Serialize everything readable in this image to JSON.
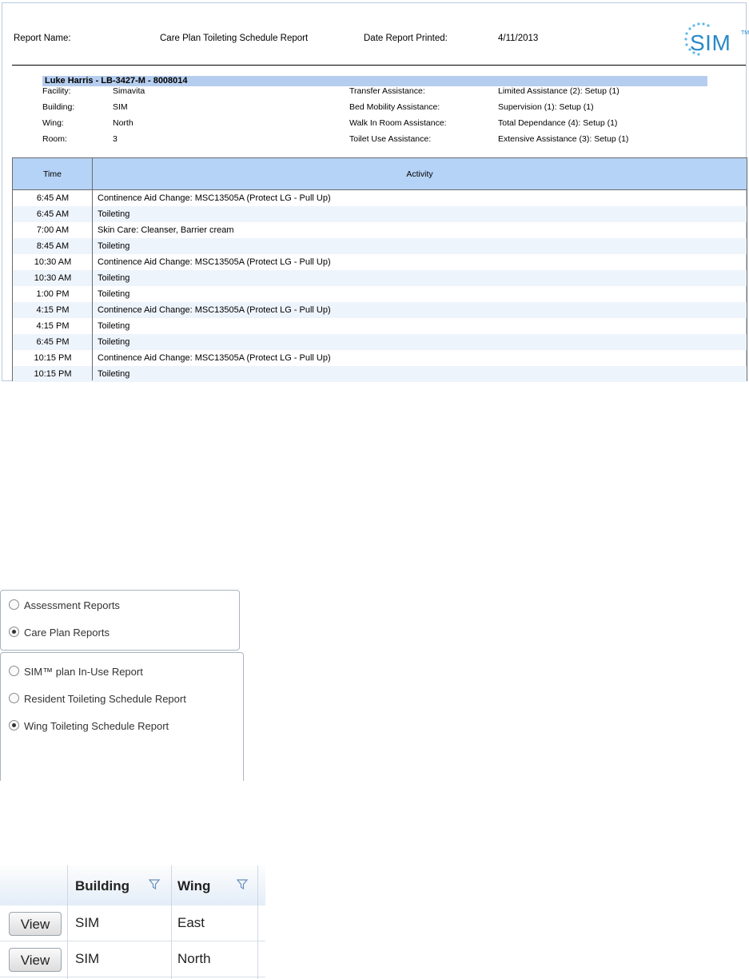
{
  "report": {
    "report_name_label": "Report Name:",
    "report_name": "Care Plan Toileting Schedule Report",
    "date_label": "Date Report Printed:",
    "date": "4/11/2013",
    "logo_text": "SIM",
    "logo_tm": "TM",
    "resident": "Luke Harris - LB-3427-M - 8008014",
    "left_info": [
      {
        "label": "Facility:",
        "value": "Simavita"
      },
      {
        "label": "Building:",
        "value": "SIM"
      },
      {
        "label": "Wing:",
        "value": "North"
      },
      {
        "label": "Room:",
        "value": "3"
      }
    ],
    "right_info": [
      {
        "label": "Transfer Assistance:",
        "value": "Limited Assistance (2): Setup (1)"
      },
      {
        "label": "Bed Mobility Assistance:",
        "value": "Supervision (1): Setup (1)"
      },
      {
        "label": "Walk In Room Assistance:",
        "value": "Total Dependance (4): Setup (1)"
      },
      {
        "label": "Toilet Use Assistance:",
        "value": "Extensive Assistance (3): Setup (1)"
      }
    ],
    "columns": {
      "time": "Time",
      "activity": "Activity"
    },
    "rows": [
      {
        "time": "6:45 AM",
        "activity": "Continence Aid Change: MSC13505A (Protect LG - Pull Up)"
      },
      {
        "time": "6:45 AM",
        "activity": "Toileting"
      },
      {
        "time": "7:00 AM",
        "activity": "Skin Care: Cleanser, Barrier cream"
      },
      {
        "time": "8:45 AM",
        "activity": "Toileting"
      },
      {
        "time": "10:30 AM",
        "activity": "Continence Aid Change: MSC13505A (Protect LG - Pull Up)"
      },
      {
        "time": "10:30 AM",
        "activity": "Toileting"
      },
      {
        "time": "1:00 PM",
        "activity": "Toileting"
      },
      {
        "time": "4:15 PM",
        "activity": "Continence Aid Change: MSC13505A (Protect LG - Pull Up)"
      },
      {
        "time": "4:15 PM",
        "activity": "Toileting"
      },
      {
        "time": "6:45 PM",
        "activity": "Toileting"
      },
      {
        "time": "10:15 PM",
        "activity": "Continence Aid Change: MSC13505A (Protect LG - Pull Up)"
      },
      {
        "time": "10:15 PM",
        "activity": "Toileting"
      }
    ]
  },
  "report_type": {
    "options": [
      {
        "label": "Assessment Reports",
        "selected": false
      },
      {
        "label": "Care Plan Reports",
        "selected": true
      }
    ]
  },
  "care_plan_reports": {
    "options": [
      {
        "label": "SIM™ plan In-Use Report",
        "selected": false
      },
      {
        "label": "Resident Toileting Schedule Report",
        "selected": false
      },
      {
        "label": "Wing Toileting Schedule Report",
        "selected": true
      }
    ]
  },
  "grid": {
    "columns": {
      "building": "Building",
      "wing": "Wing"
    },
    "view_label": "View",
    "rows": [
      {
        "building": "SIM",
        "wing": "East"
      },
      {
        "building": "SIM",
        "wing": "North"
      }
    ]
  },
  "colors": {
    "accent": "#2a88c8",
    "header_fill": "#b5d3f6",
    "resident_bar": "#b5cdee"
  }
}
